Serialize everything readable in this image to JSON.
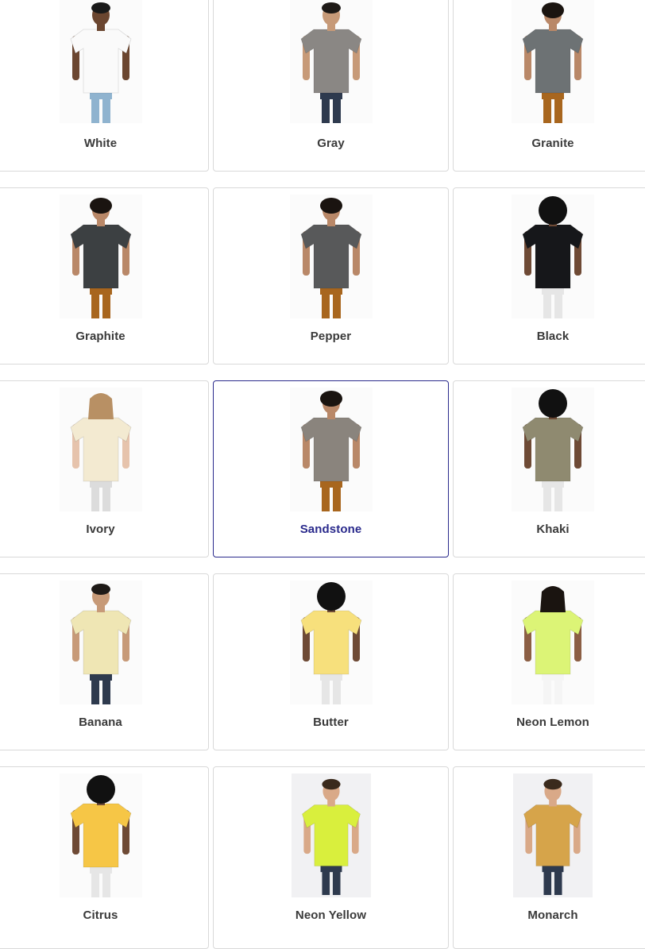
{
  "selected": "Sandstone",
  "swatches": [
    {
      "label": "White",
      "shirt": "#fafafa",
      "pants": "#8fb3cf",
      "skin": "#6b4630",
      "hair": "#1a1a1a",
      "hair_style": "short"
    },
    {
      "label": "Gray",
      "shirt": "#8a8784",
      "pants": "#2e3a4e",
      "skin": "#c79a78",
      "hair": "#1e1a17",
      "hair_style": "short"
    },
    {
      "label": "Granite",
      "shirt": "#6d7274",
      "pants": "#a8661e",
      "skin": "#b98868",
      "hair": "#1a1410",
      "hair_style": "curly"
    },
    {
      "label": "Graphite",
      "shirt": "#3c4042",
      "pants": "#a8661e",
      "skin": "#b98868",
      "hair": "#1a1410",
      "hair_style": "curly"
    },
    {
      "label": "Pepper",
      "shirt": "#58595a",
      "pants": "#a8661e",
      "skin": "#b98868",
      "hair": "#1a1410",
      "hair_style": "curly"
    },
    {
      "label": "Black",
      "shirt": "#16171a",
      "pants": "#e6e6e6",
      "skin": "#6e4a35",
      "hair": "#111111",
      "hair_style": "afro"
    },
    {
      "label": "Ivory",
      "shirt": "#f3ead1",
      "pants": "#dcdcdc",
      "skin": "#e6c3ac",
      "hair": "#b89064",
      "hair_style": "long"
    },
    {
      "label": "Sandstone",
      "shirt": "#8a847d",
      "pants": "#a8661e",
      "skin": "#b98868",
      "hair": "#1a1410",
      "hair_style": "curly"
    },
    {
      "label": "Khaki",
      "shirt": "#8f8a70",
      "pants": "#e6e6e6",
      "skin": "#6e4a35",
      "hair": "#111111",
      "hair_style": "afro"
    },
    {
      "label": "Banana",
      "shirt": "#efe6b4",
      "pants": "#2e3a4e",
      "skin": "#c79a78",
      "hair": "#1e1a17",
      "hair_style": "short"
    },
    {
      "label": "Butter",
      "shirt": "#f7e07c",
      "pants": "#e6e6e6",
      "skin": "#6e4a35",
      "hair": "#111111",
      "hair_style": "afro"
    },
    {
      "label": "Neon Lemon",
      "shirt": "#dcf476",
      "pants": "#f5f5f5",
      "skin": "#8b5e44",
      "hair": "#1a1410",
      "hair_style": "long"
    },
    {
      "label": "Citrus",
      "shirt": "#f6c646",
      "pants": "#e6e6e6",
      "skin": "#6e4a35",
      "hair": "#111111",
      "hair_style": "afro"
    },
    {
      "label": "Neon Yellow",
      "shirt": "#d9ef3d",
      "pants": "#2e3a4e",
      "skin": "#d9a988",
      "hair": "#3a2a1c",
      "hair_style": "short"
    },
    {
      "label": "Monarch",
      "shirt": "#d6a44a",
      "pants": "#2e3a4e",
      "skin": "#d9a988",
      "hair": "#3a2a1c",
      "hair_style": "short"
    }
  ]
}
